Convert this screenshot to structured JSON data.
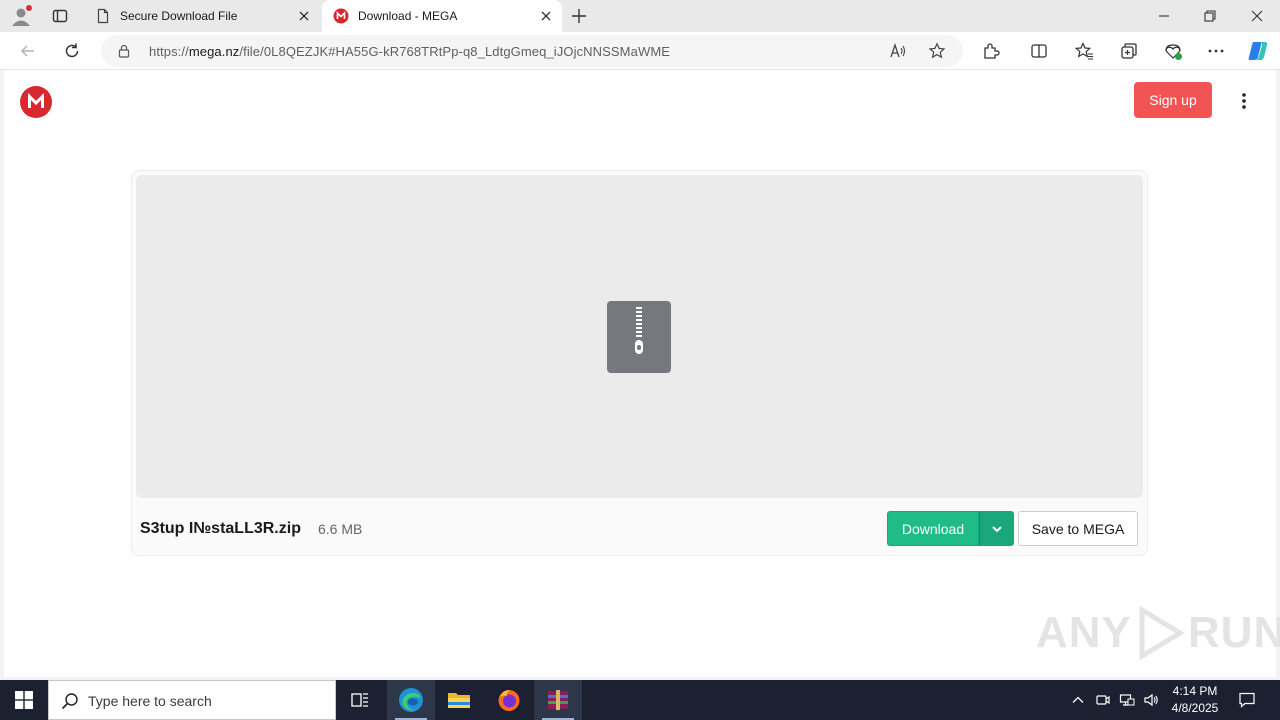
{
  "browser": {
    "tabs": [
      {
        "title": "Secure Download File",
        "active": false
      },
      {
        "title": "Download - MEGA",
        "active": true
      }
    ],
    "url_prefix": "https://",
    "url_host": "mega.nz",
    "url_path": "/file/0L8QEZJK#HA55G-kR768TRtPp-q8_LdtgGmeq_iJOjcNNSSMaWME"
  },
  "page": {
    "signup_label": "Sign up",
    "file": {
      "name": "S3tup I№staLL3R.zip",
      "size": "6.6 MB"
    },
    "download_label": "Download",
    "save_label": "Save to MEGA",
    "watermark_left": "ANY",
    "watermark_right": "RUN",
    "colors": {
      "mega_red": "#d9272e",
      "signup": "#f15453",
      "download_green": "#1fbc87"
    }
  },
  "taskbar": {
    "search_placeholder": "Type here to search",
    "time": "4:14 PM",
    "date": "4/8/2025",
    "apps": [
      "task-view-icon",
      "edge-icon",
      "file-explorer-icon",
      "firefox-icon",
      "winrar-icon"
    ]
  }
}
